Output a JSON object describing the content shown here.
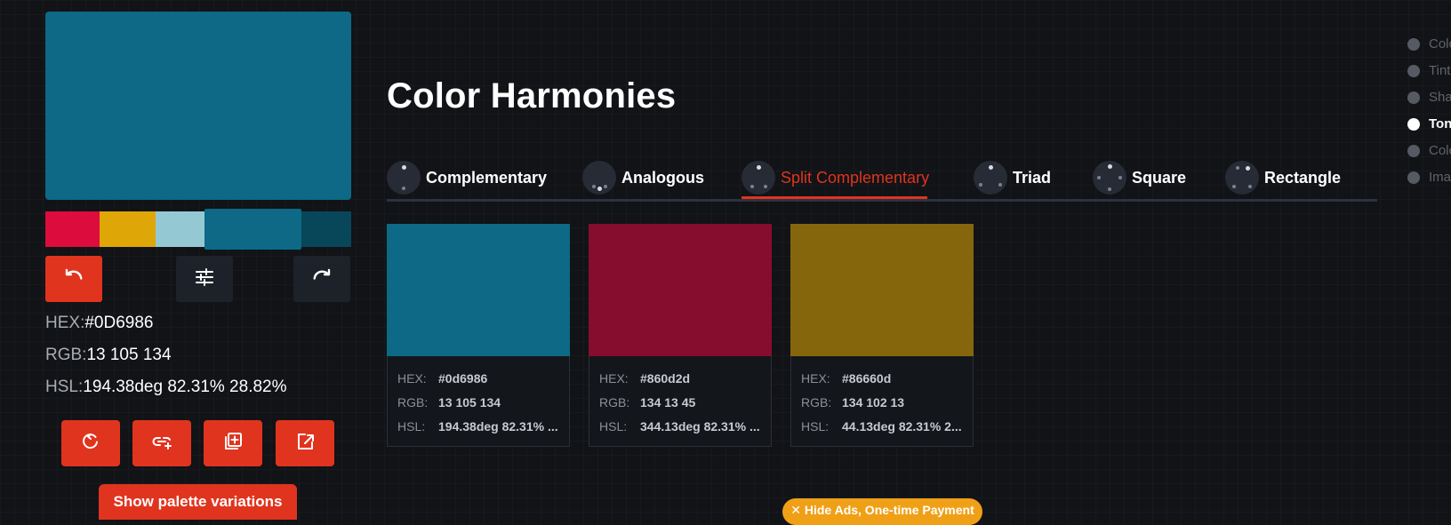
{
  "current_color": {
    "swatch": "#0D6986",
    "hex_key": "HEX:",
    "hex_value": "#0D6986",
    "rgb_key": "RGB:",
    "rgb_value": "13 105 134",
    "hsl_key": "HSL:",
    "hsl_value": "194.38deg 82.31% 28.82%"
  },
  "palette": [
    {
      "color": "#DC0C3C"
    },
    {
      "color": "#DFA607"
    },
    {
      "color": "#94C9D4"
    },
    {
      "color": "#0D6986",
      "active": true
    },
    {
      "color": "#08465A"
    }
  ],
  "controls": {
    "undo_icon": "undo-icon",
    "adjust_icon": "sliders-icon",
    "redo_icon": "redo-icon"
  },
  "actions": [
    "refresh-icon",
    "link-add-icon",
    "add-to-collection-icon",
    "share-icon"
  ],
  "show_variations_label": "Show palette variations",
  "title": "Color Harmonies",
  "tabs": [
    {
      "label": "Complementary"
    },
    {
      "label": "Analogous"
    },
    {
      "label": "Split Complementary",
      "active": true
    },
    {
      "label": "Triad"
    },
    {
      "label": "Square"
    },
    {
      "label": "Rectangle"
    }
  ],
  "harmony_cards": [
    {
      "swatch": "#0d6986",
      "hex_key": "HEX:",
      "hex": "#0d6986",
      "rgb_key": "RGB:",
      "rgb": "13 105 134",
      "hsl_key": "HSL:",
      "hsl": "194.38deg 82.31% ..."
    },
    {
      "swatch": "#860d2d",
      "hex_key": "HEX:",
      "hex": "#860d2d",
      "rgb_key": "RGB:",
      "rgb": "134 13 45",
      "hsl_key": "HSL:",
      "hsl": "344.13deg 82.31% ..."
    },
    {
      "swatch": "#86660d",
      "hex_key": "HEX:",
      "hex": "#86660d",
      "rgb_key": "RGB:",
      "rgb": "134 102 13",
      "hsl_key": "HSL:",
      "hsl": "44.13deg 82.31% 2..."
    }
  ],
  "side_nav": [
    {
      "label": "Colo"
    },
    {
      "label": "Tint"
    },
    {
      "label": "Sha"
    },
    {
      "label": "Ton",
      "active": true
    },
    {
      "label": "Cole"
    },
    {
      "label": "Ima"
    }
  ],
  "hide_ads_label": "✕ Hide Ads, One-time Payment",
  "accent_color": "#e0341f"
}
